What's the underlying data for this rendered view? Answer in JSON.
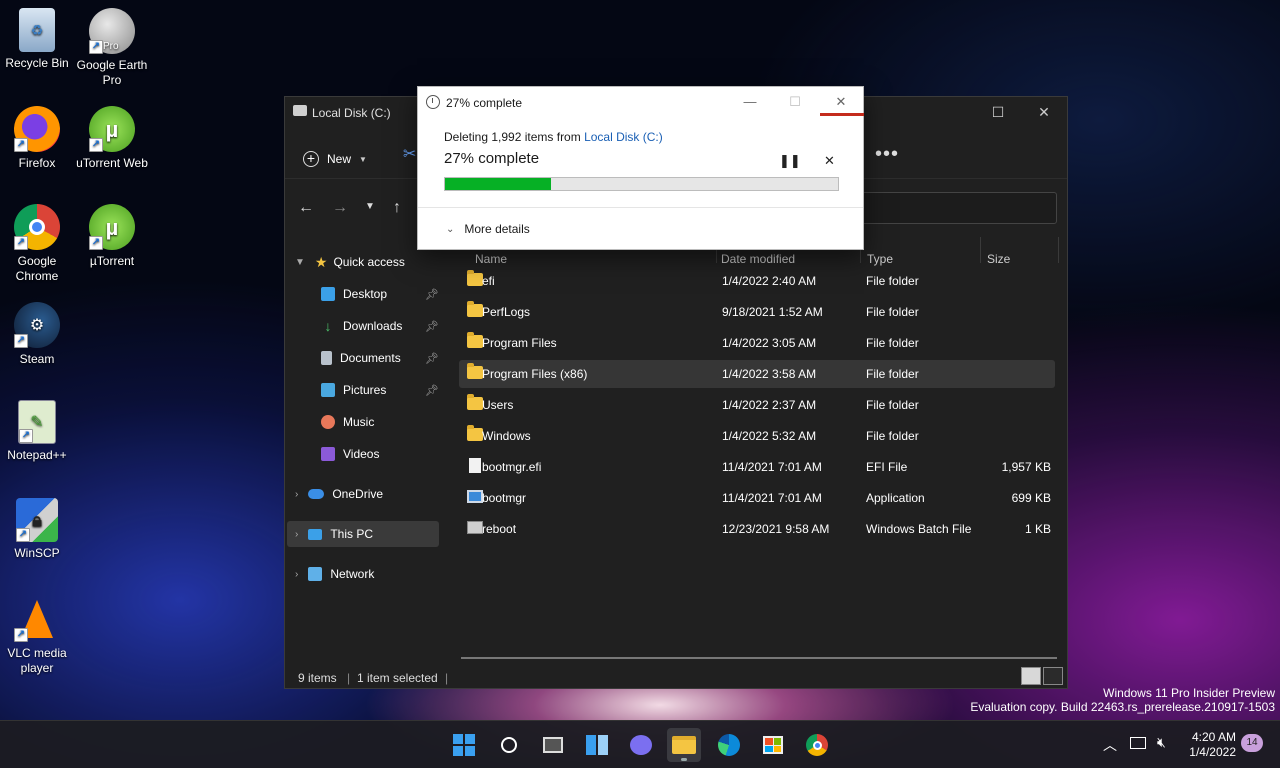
{
  "desktop": {
    "icons": [
      {
        "label": "Recycle Bin"
      },
      {
        "label": "Google Earth Pro",
        "badge": "Pro"
      },
      {
        "label": "Firefox"
      },
      {
        "label": "uTorrent Web"
      },
      {
        "label": "Google Chrome"
      },
      {
        "label": "µTorrent"
      },
      {
        "label": "Steam"
      },
      {
        "label": "Notepad++"
      },
      {
        "label": "WinSCP"
      },
      {
        "label": "VLC media player"
      }
    ]
  },
  "explorer": {
    "title": "Local Disk (C:)",
    "toolbar": {
      "new_label": "New"
    },
    "sidebar": {
      "quick_access": "Quick access",
      "items": [
        {
          "label": "Desktop"
        },
        {
          "label": "Downloads"
        },
        {
          "label": "Documents"
        },
        {
          "label": "Pictures"
        },
        {
          "label": "Music"
        },
        {
          "label": "Videos"
        }
      ],
      "onedrive": "OneDrive",
      "this_pc": "This PC",
      "network": "Network"
    },
    "columns": {
      "name": "Name",
      "date": "Date modified",
      "type": "Type",
      "size": "Size"
    },
    "files": [
      {
        "name": "efi",
        "date": "1/4/2022 2:40 AM",
        "type": "File folder",
        "size": "",
        "kind": "folder"
      },
      {
        "name": "PerfLogs",
        "date": "9/18/2021 1:52 AM",
        "type": "File folder",
        "size": "",
        "kind": "folder"
      },
      {
        "name": "Program Files",
        "date": "1/4/2022 3:05 AM",
        "type": "File folder",
        "size": "",
        "kind": "folder"
      },
      {
        "name": "Program Files (x86)",
        "date": "1/4/2022 3:58 AM",
        "type": "File folder",
        "size": "",
        "kind": "folder",
        "selected": true
      },
      {
        "name": "Users",
        "date": "1/4/2022 2:37 AM",
        "type": "File folder",
        "size": "",
        "kind": "folder"
      },
      {
        "name": "Windows",
        "date": "1/4/2022 5:32 AM",
        "type": "File folder",
        "size": "",
        "kind": "folder"
      },
      {
        "name": "bootmgr.efi",
        "date": "11/4/2021 7:01 AM",
        "type": "EFI File",
        "size": "1,957 KB",
        "kind": "doc"
      },
      {
        "name": "bootmgr",
        "date": "11/4/2021 7:01 AM",
        "type": "Application",
        "size": "699 KB",
        "kind": "app"
      },
      {
        "name": "reboot",
        "date": "12/23/2021 9:58 AM",
        "type": "Windows Batch File",
        "size": "1 KB",
        "kind": "bat"
      }
    ],
    "status": {
      "count": "9 items",
      "selected": "1 item selected"
    }
  },
  "dialog": {
    "title": "27% complete",
    "desc_prefix": "Deleting 1,992 items from ",
    "desc_link": "Local Disk (C:)",
    "big": "27% complete",
    "progress": 0.27,
    "more_details": "More details"
  },
  "watermark": {
    "line1": "Windows 11 Pro Insider Preview",
    "line2": "Evaluation copy. Build 22463.rs_prerelease.210917-1503"
  },
  "taskbar": {
    "time": "4:20 AM",
    "date": "1/4/2022",
    "notifications": "14"
  },
  "colors": {
    "progress": "#06b025",
    "link": "#1a5fb4",
    "close_hover": "#c42b1c"
  }
}
